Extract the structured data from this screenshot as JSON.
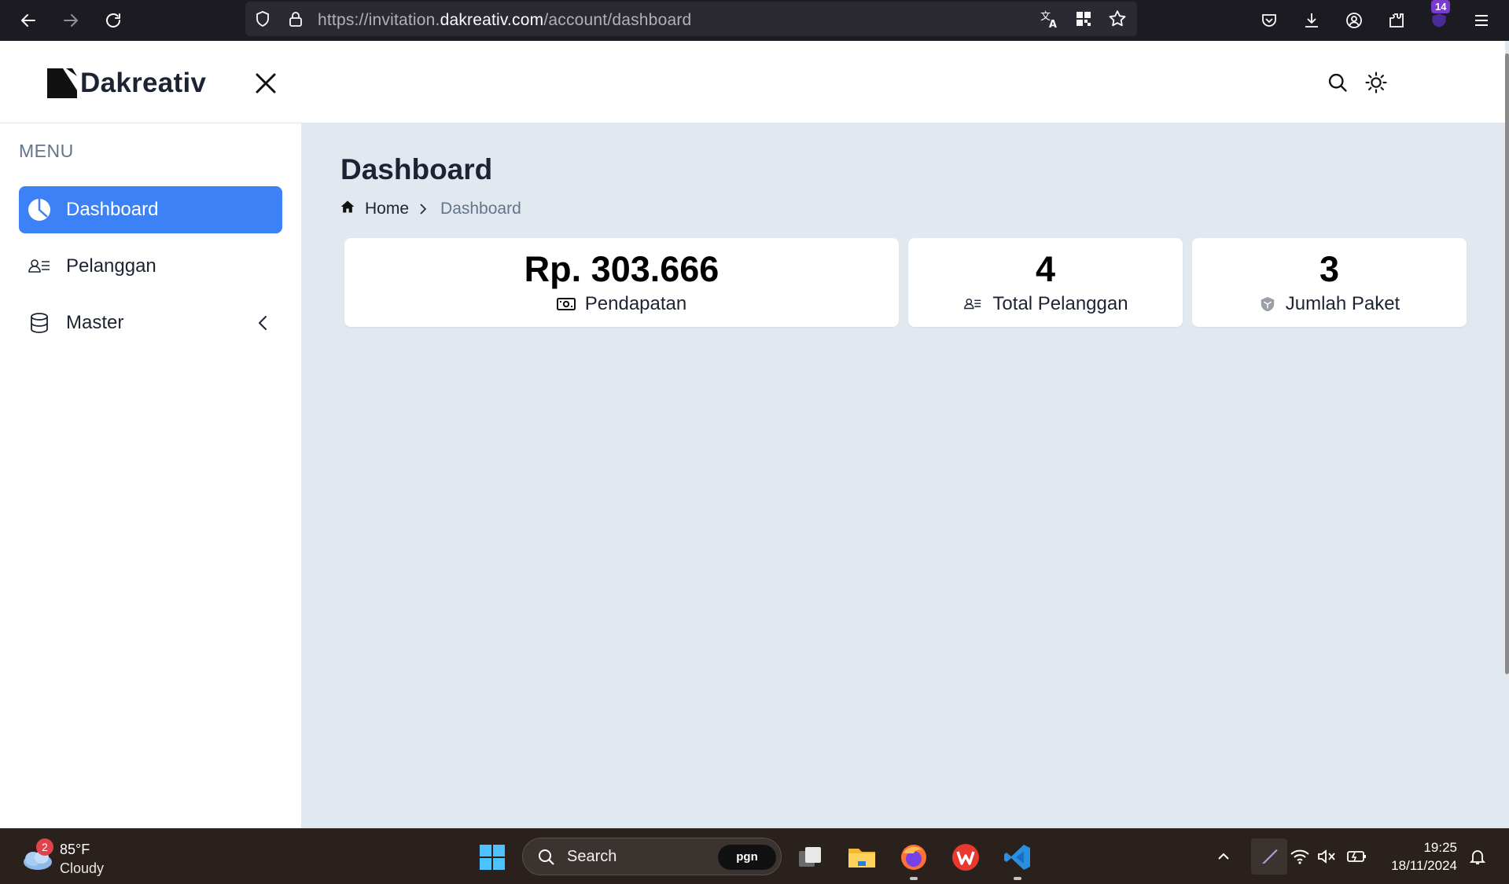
{
  "browser": {
    "url_prefix": "https://invitation.",
    "url_host": "dakreativ.com",
    "url_path": "/account/dashboard",
    "extension_badge": "14"
  },
  "header": {
    "logo_text": "Dakreativ"
  },
  "sidebar": {
    "menu_title": "MENU",
    "items": [
      {
        "label": "Dashboard",
        "icon": "pie-chart-icon",
        "active": true
      },
      {
        "label": "Pelanggan",
        "icon": "user-list-icon",
        "active": false
      },
      {
        "label": "Master",
        "icon": "database-icon",
        "active": false
      }
    ]
  },
  "main": {
    "title": "Dashboard",
    "breadcrumb": {
      "home": "Home",
      "current": "Dashboard"
    },
    "cards": [
      {
        "value": "Rp. 303.666",
        "label": "Pendapatan",
        "icon": "money-icon"
      },
      {
        "value": "4",
        "label": "Total Pelanggan",
        "icon": "user-list-icon"
      },
      {
        "value": "3",
        "label": "Jumlah Paket",
        "icon": "package-icon"
      }
    ]
  },
  "taskbar": {
    "weather_badge": "2",
    "weather_temp": "85°F",
    "weather_condition": "Cloudy",
    "search_label": "Search",
    "search_badge": "pgn",
    "time": "19:25",
    "date": "18/11/2024"
  },
  "colors": {
    "accent": "#3c82f6",
    "page_bg": "#e2e8f0",
    "text_dark": "#1c2434"
  }
}
